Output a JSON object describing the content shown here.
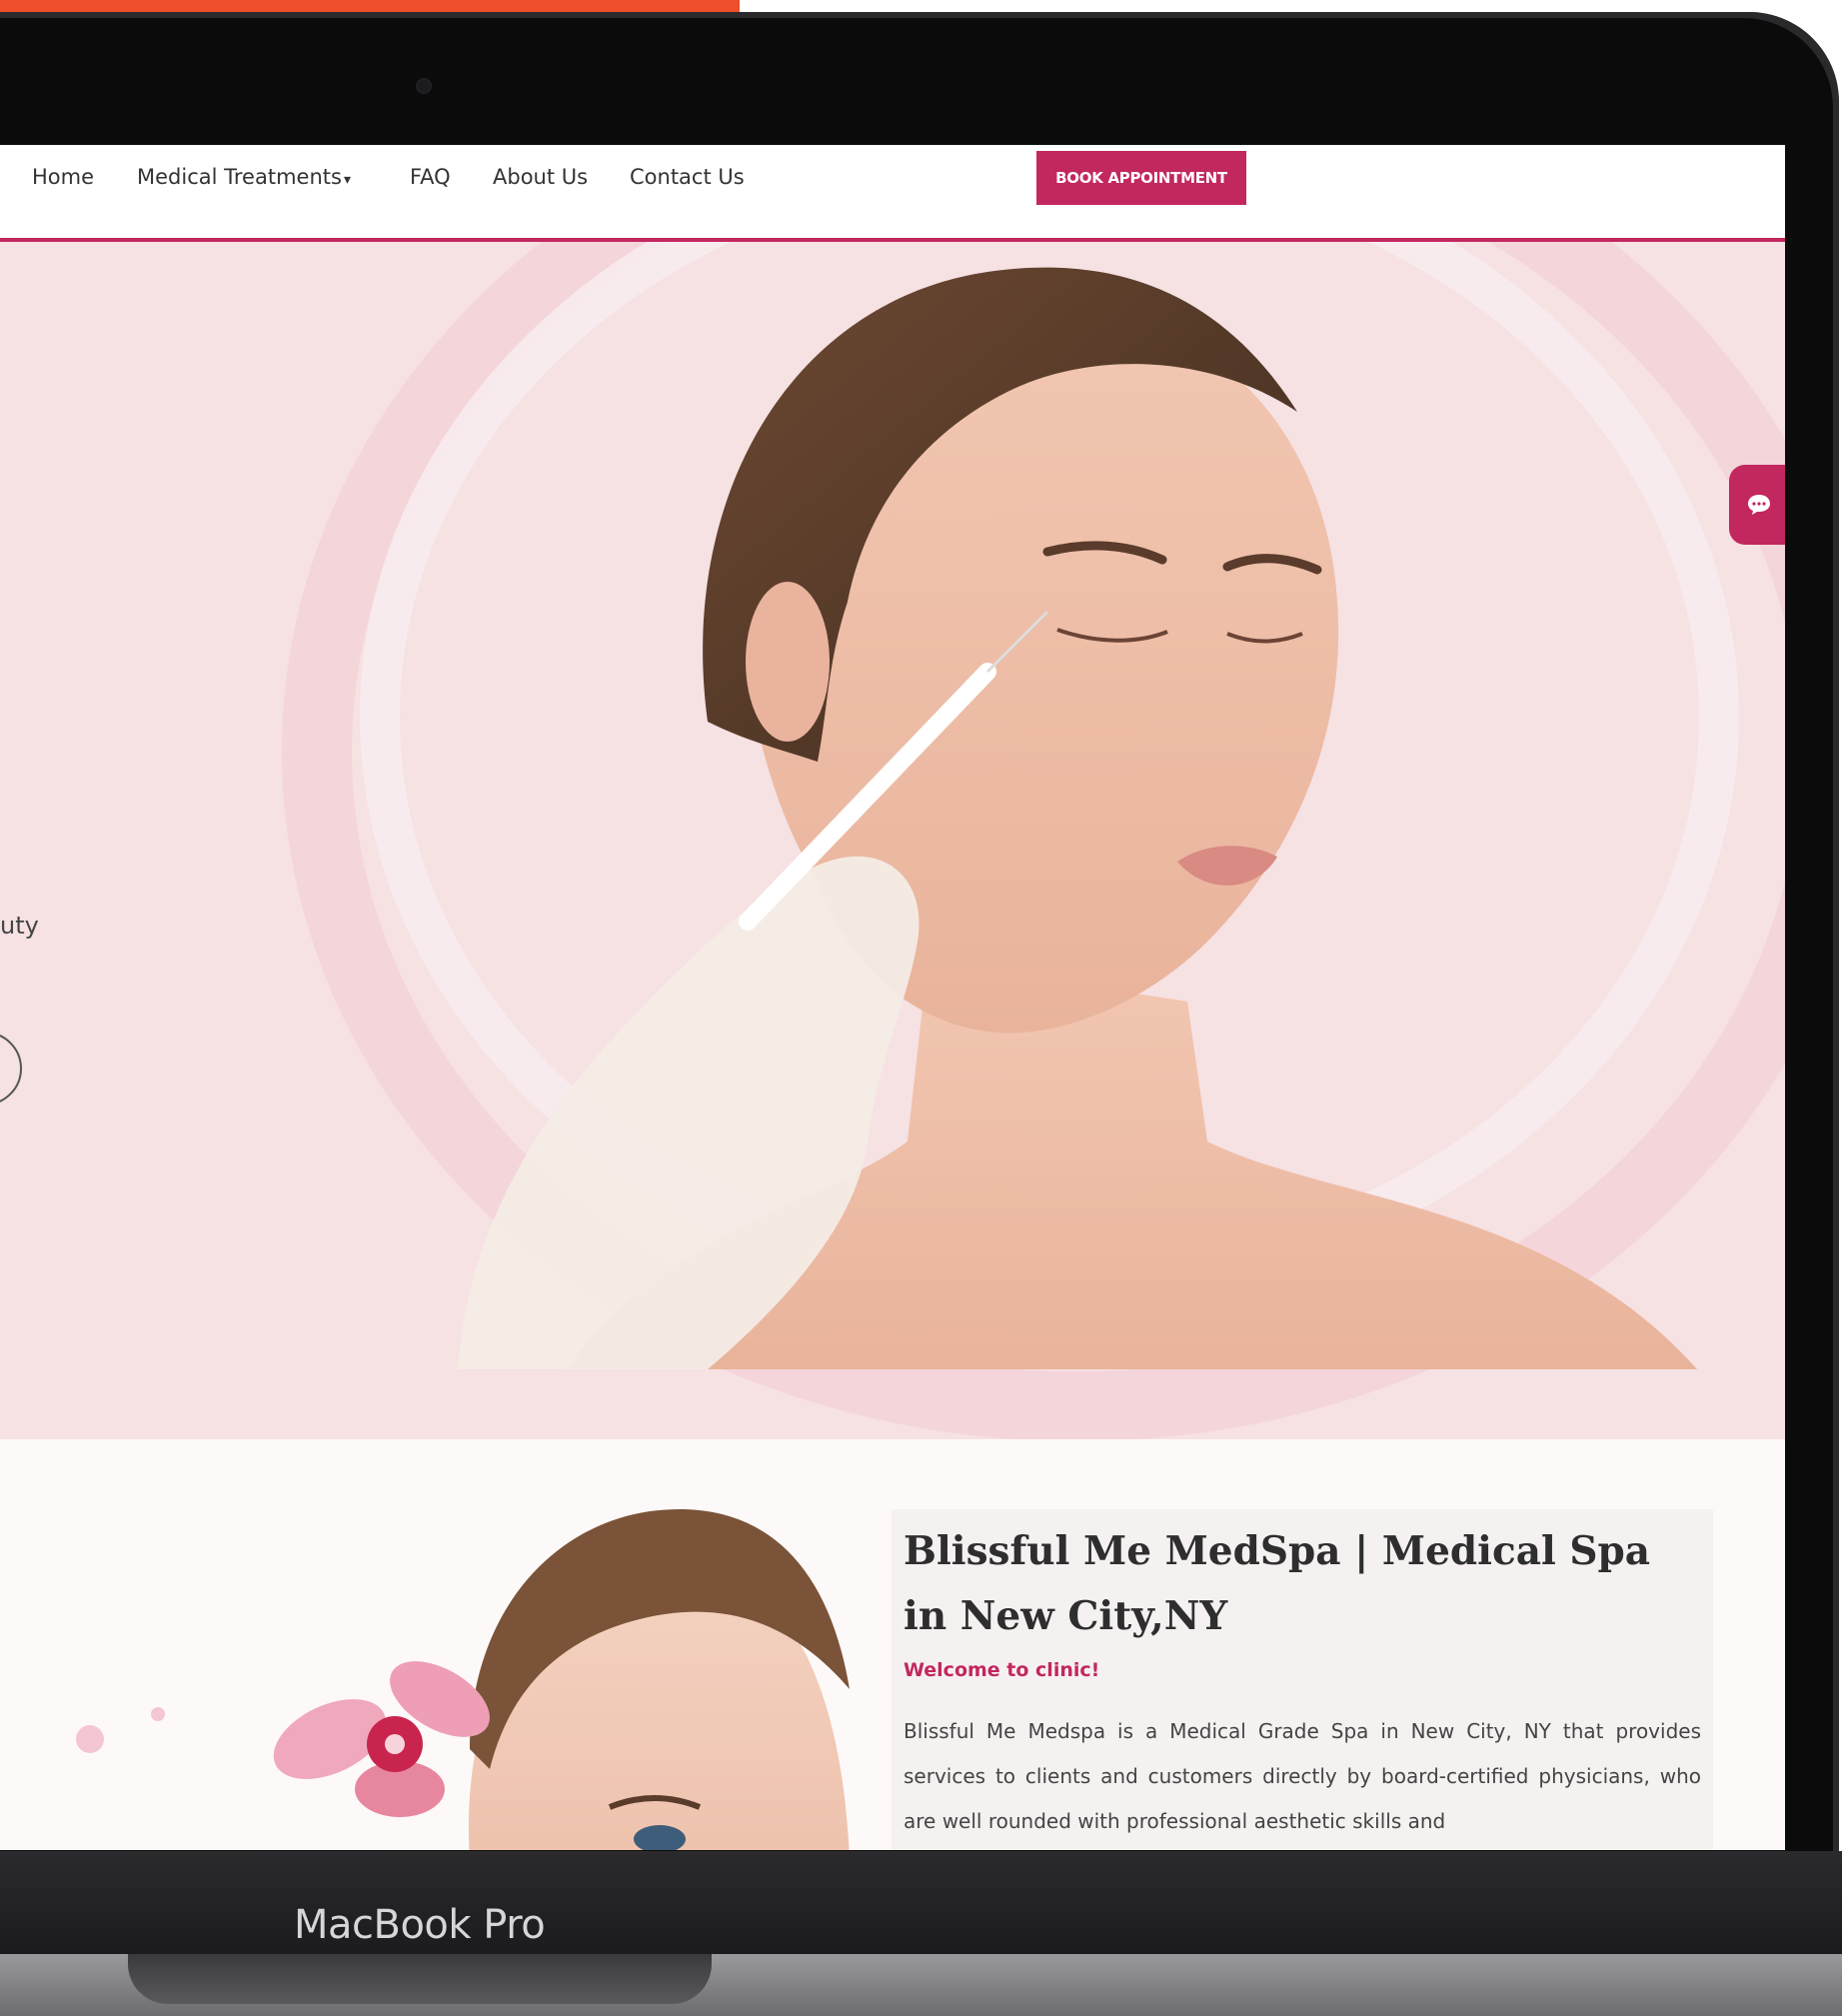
{
  "nav": {
    "items": [
      "Home",
      "Medical Treatments",
      "FAQ",
      "About Us",
      "Contact Us"
    ],
    "caret": "▾",
    "cta": "BOOK APPOINTMENT"
  },
  "hero": {
    "partial_text": "uty"
  },
  "about": {
    "title": "Blissful Me MedSpa | Medical Spa in New City,NY",
    "subtitle": "Welcome to clinic!",
    "body": "Blissful Me Medspa is a Medical Grade Spa in New City, NY that provides services to clients and customers directly by board-certified physicians, who are well rounded with professional aesthetic skills and"
  },
  "device": {
    "label": "MacBook Pro"
  },
  "colors": {
    "brand": "#c2275f",
    "accent_bar": "#ee4e2c",
    "hero_bg": "#f6e1e3"
  },
  "icons": {
    "chat": "chat-bubble-icon"
  }
}
